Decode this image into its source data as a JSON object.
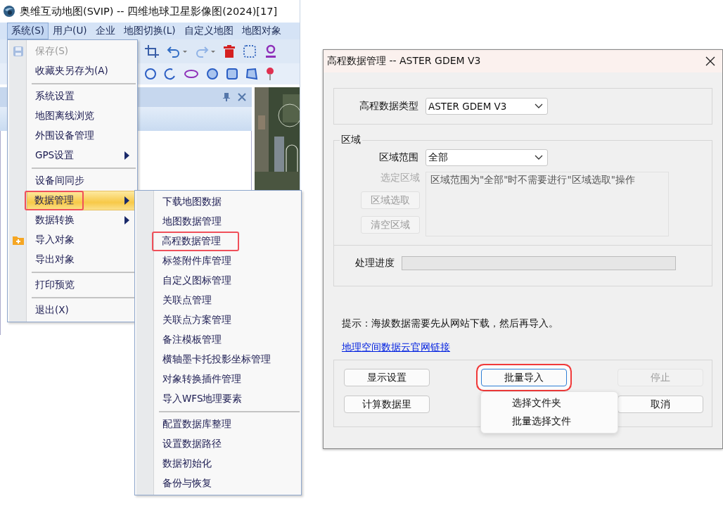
{
  "app": {
    "title": "奥维互动地图(SVIP) -- 四维地球卫星影像图(2024)[17]",
    "menubar": [
      {
        "label": "系统(S)",
        "selected": true
      },
      {
        "label": "用户(U)",
        "selected": false
      },
      {
        "label": "企业",
        "selected": false
      },
      {
        "label": "地图切换(L)",
        "selected": false
      },
      {
        "label": "自定义地图",
        "selected": false
      },
      {
        "label": "地图对象",
        "selected": false
      }
    ],
    "system_menu": [
      {
        "kind": "item",
        "label": "保存(S)",
        "disabled": true,
        "submenu": false,
        "selected": false,
        "highlighted": false
      },
      {
        "kind": "item",
        "label": "收藏夹另存为(A)",
        "disabled": false,
        "submenu": false,
        "selected": false,
        "highlighted": false
      },
      {
        "kind": "separator"
      },
      {
        "kind": "item",
        "label": "系统设置",
        "disabled": false,
        "submenu": false,
        "selected": false,
        "highlighted": false
      },
      {
        "kind": "item",
        "label": "地图离线浏览",
        "disabled": false,
        "submenu": false,
        "selected": false,
        "highlighted": false
      },
      {
        "kind": "item",
        "label": "外围设备管理",
        "disabled": false,
        "submenu": false,
        "selected": false,
        "highlighted": false
      },
      {
        "kind": "item",
        "label": "GPS设置",
        "disabled": false,
        "submenu": true,
        "selected": false,
        "highlighted": false
      },
      {
        "kind": "separator"
      },
      {
        "kind": "item",
        "label": "设备间同步",
        "disabled": false,
        "submenu": false,
        "selected": false,
        "highlighted": false
      },
      {
        "kind": "item",
        "label": "数据管理",
        "disabled": false,
        "submenu": true,
        "selected": true,
        "highlighted": true
      },
      {
        "kind": "item",
        "label": "数据转换",
        "disabled": false,
        "submenu": true,
        "selected": false,
        "highlighted": false
      },
      {
        "kind": "item",
        "label": "导入对象",
        "disabled": false,
        "submenu": false,
        "selected": false,
        "highlighted": false
      },
      {
        "kind": "item",
        "label": "导出对象",
        "disabled": false,
        "submenu": false,
        "selected": false,
        "highlighted": false
      },
      {
        "kind": "separator"
      },
      {
        "kind": "item",
        "label": "打印预览",
        "disabled": false,
        "submenu": false,
        "selected": false,
        "highlighted": false
      },
      {
        "kind": "separator"
      },
      {
        "kind": "item",
        "label": "退出(X)",
        "disabled": false,
        "submenu": false,
        "selected": false,
        "highlighted": false
      }
    ],
    "data_submenu": [
      {
        "kind": "item",
        "label": "下载地图数据",
        "highlighted": false
      },
      {
        "kind": "item",
        "label": "地图数据管理",
        "highlighted": false
      },
      {
        "kind": "item",
        "label": "高程数据管理",
        "highlighted": true
      },
      {
        "kind": "item",
        "label": "标签附件库管理",
        "highlighted": false
      },
      {
        "kind": "item",
        "label": "自定义图标管理",
        "highlighted": false
      },
      {
        "kind": "item",
        "label": "关联点管理",
        "highlighted": false
      },
      {
        "kind": "item",
        "label": "关联点方案管理",
        "highlighted": false
      },
      {
        "kind": "item",
        "label": "备注模板管理",
        "highlighted": false
      },
      {
        "kind": "item",
        "label": "横轴墨卡托投影坐标管理",
        "highlighted": false
      },
      {
        "kind": "item",
        "label": "对象转换插件管理",
        "highlighted": false
      },
      {
        "kind": "item",
        "label": "导入WFS地理要素",
        "highlighted": false
      },
      {
        "kind": "separator"
      },
      {
        "kind": "item",
        "label": "配置数据库整理",
        "highlighted": false
      },
      {
        "kind": "item",
        "label": "设置数据路径",
        "highlighted": false
      },
      {
        "kind": "item",
        "label": "数据初始化",
        "highlighted": false
      },
      {
        "kind": "item",
        "label": "备份与恢复",
        "highlighted": false
      }
    ]
  },
  "dialog": {
    "title": "高程数据管理 -- ASTER GDEM V3",
    "data_type": {
      "label": "高程数据类型",
      "value": "ASTER GDEM V3"
    },
    "region": {
      "legend": "区域",
      "range_label": "区域范围",
      "range_value": "全部",
      "area_label": "选定区域",
      "area_disabled": true,
      "area_text": "区域范围为\"全部\"时不需要进行\"区域选取\"操作",
      "buttons": [
        {
          "label": "区域选取",
          "disabled": true
        },
        {
          "label": "清空区域",
          "disabled": true
        }
      ]
    },
    "progress": {
      "label": "处理进度",
      "level": 0
    },
    "hint": "提示：海拔数据需要先从网站下载，然后再导入。",
    "link": "地理空间数据云官网链接",
    "button_rows": [
      [
        {
          "label": "显示设置",
          "disabled": false,
          "highlighted": false
        },
        {
          "label": "批量导入",
          "disabled": false,
          "highlighted": true
        },
        {
          "label": "停止",
          "disabled": true,
          "highlighted": false
        }
      ],
      [
        {
          "label": "计算数据里",
          "disabled": false,
          "highlighted": false
        },
        {
          "label": "取消",
          "disabled": false,
          "highlighted": false
        }
      ]
    ],
    "popup_menu": [
      "选择文件夹",
      "批量选择文件"
    ]
  }
}
